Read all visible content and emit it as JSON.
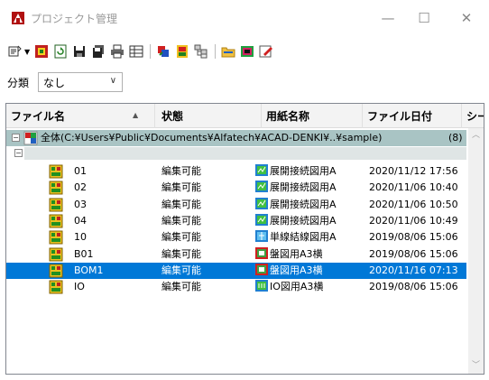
{
  "window": {
    "title": "プロジェクト管理",
    "minimize_glyph": "—",
    "maximize_glyph": "☐",
    "close_glyph": "✕"
  },
  "toolbar": {
    "icons": [
      "open-folder-icon",
      "new-project-icon",
      "refresh-icon",
      "save-icon",
      "save-all-icon",
      "print-icon",
      "list-view-icon",
      "properties-icon",
      "settings-icon",
      "tree-icon",
      "folder-icon",
      "panel-icon",
      "edit-icon"
    ]
  },
  "filter": {
    "label": "分類",
    "value": "なし"
  },
  "columns": {
    "filename": "ファイル名",
    "status": "状態",
    "paper": "用紙名称",
    "date": "ファイル日付",
    "sheet": "シー"
  },
  "root": {
    "label": "全体(C:¥Users¥Public¥Documents¥Alfatech¥ACAD-DENKI¥..¥sample)",
    "count": "(8)"
  },
  "files": [
    {
      "name": "01",
      "status": "編集可能",
      "paper": "展開接続図用A",
      "date": "2020/11/12 17:56",
      "icon": "connection-diagram-icon"
    },
    {
      "name": "02",
      "status": "編集可能",
      "paper": "展開接続図用A",
      "date": "2020/11/06 10:40",
      "icon": "connection-diagram-icon"
    },
    {
      "name": "03",
      "status": "編集可能",
      "paper": "展開接続図用A",
      "date": "2020/11/06 10:50",
      "icon": "connection-diagram-icon"
    },
    {
      "name": "04",
      "status": "編集可能",
      "paper": "展開接続図用A",
      "date": "2020/11/06 10:49",
      "icon": "connection-diagram-icon"
    },
    {
      "name": "10",
      "status": "編集可能",
      "paper": "単線結線図用A",
      "date": "2019/08/06 15:06",
      "icon": "single-line-diagram-icon"
    },
    {
      "name": "B01",
      "status": "編集可能",
      "paper": "盤図用A3横",
      "date": "2019/08/06 15:06",
      "icon": "panel-diagram-icon"
    },
    {
      "name": "BOM1",
      "status": "編集可能",
      "paper": "盤図用A3横",
      "date": "2020/11/16 07:13",
      "icon": "panel-diagram-icon",
      "selected": true
    },
    {
      "name": "IO",
      "status": "編集可能",
      "paper": "IO図用A3横",
      "date": "2019/08/06 15:06",
      "icon": "io-diagram-icon"
    }
  ],
  "colors": {
    "selection": "#0078d7",
    "root_row": "#a9c4c4"
  }
}
